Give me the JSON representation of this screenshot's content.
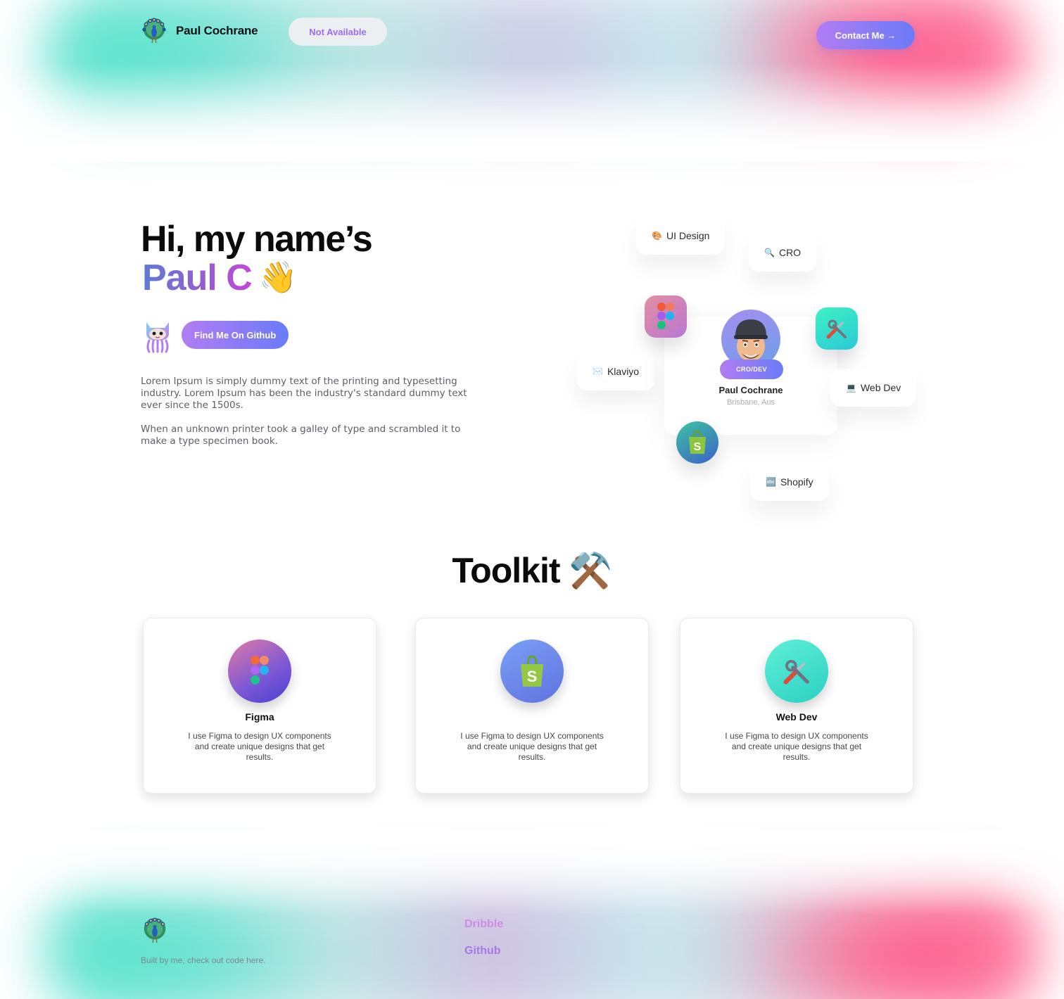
{
  "header": {
    "name": "Paul Cochrane",
    "status": "Not Available",
    "contact_label": "Contact Me →"
  },
  "hero": {
    "greeting": "Hi, my name’s",
    "name": "Paul C",
    "wave_emoji": "👋",
    "github_button": "Find Me On Github",
    "paragraph1": "Lorem Ipsum is simply dummy text of the printing and typesetting industry. Lorem Ipsum has been the industry's standard dummy text ever since the 1500s.",
    "paragraph2": "When an unknown printer took a galley of type and scrambled it to make a type specimen book."
  },
  "profile_graphic": {
    "chips": [
      {
        "icon": "🎨",
        "label": "UI Design"
      },
      {
        "icon": "🔍",
        "label": "CRO"
      },
      {
        "icon": "✉️",
        "label": "Klaviyo"
      },
      {
        "icon": "💻",
        "label": "Web Dev"
      },
      {
        "icon": "🔤",
        "label": "Shopify"
      }
    ],
    "role": "CRO/DEV",
    "name": "Paul Cochrane",
    "location": "Brisbane, Aus"
  },
  "toolkit": {
    "title": "Toolkit",
    "emoji": "⚒️",
    "cards": [
      {
        "name": "Figma",
        "description": "I use Figma to design UX components and create unique designs that get results."
      },
      {
        "name": "",
        "description": "I use Figma to design UX components and create unique designs that get results."
      },
      {
        "name": "Web Dev",
        "description": "I use Figma to design UX components and create unique designs that get results."
      }
    ]
  },
  "footer": {
    "note": "Built by me, check out code here.",
    "links": [
      "Dribble",
      "Github"
    ]
  },
  "colors": {
    "accent_start": "#b27cf3",
    "accent_end": "#6a7bf7",
    "teal_glow": "#3ee3c2",
    "pink_glow": "#ff3b7a"
  }
}
